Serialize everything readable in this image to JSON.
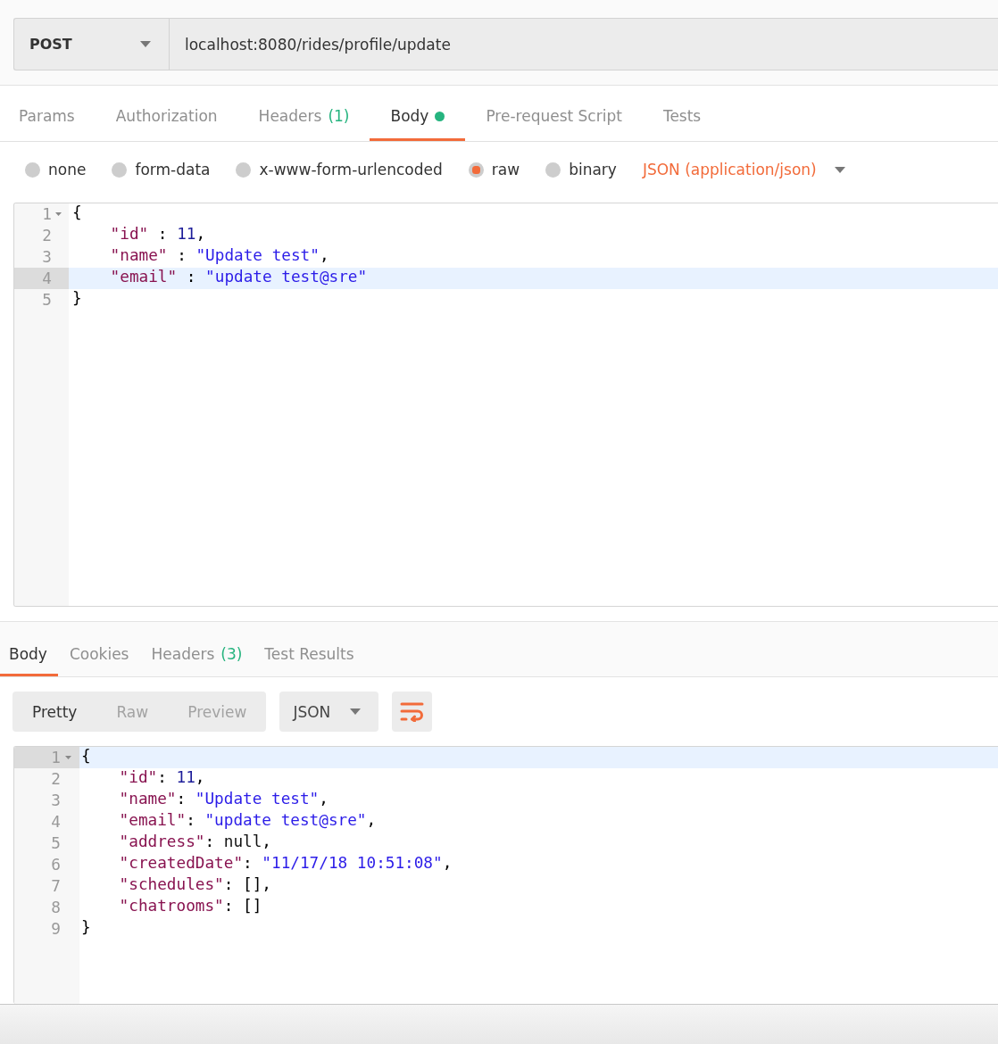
{
  "request": {
    "method": "POST",
    "url": "localhost:8080/rides/profile/update"
  },
  "request_tabs": [
    {
      "label": "Params",
      "selected": false,
      "indicator": false
    },
    {
      "label": "Authorization",
      "selected": false,
      "indicator": false
    },
    {
      "label": "Headers",
      "count": "(1)",
      "selected": false,
      "indicator": false
    },
    {
      "label": "Body",
      "selected": true,
      "indicator": true
    },
    {
      "label": "Pre-request Script",
      "selected": false,
      "indicator": false
    },
    {
      "label": "Tests",
      "selected": false,
      "indicator": false
    }
  ],
  "body_types": [
    {
      "label": "none",
      "selected": false
    },
    {
      "label": "form-data",
      "selected": false
    },
    {
      "label": "x-www-form-urlencoded",
      "selected": false
    },
    {
      "label": "raw",
      "selected": true
    },
    {
      "label": "binary",
      "selected": false
    }
  ],
  "content_type": {
    "label": "JSON (application/json)"
  },
  "request_body": {
    "lines": [
      {
        "number": "1",
        "foldable": true,
        "active": false,
        "tokens": [
          {
            "kind": "punct",
            "text": "{"
          }
        ],
        "children": [
          {
            "number": "2",
            "foldable": false,
            "active": false,
            "tokens": [
              {
                "kind": "key",
                "text": "\"id\""
              },
              {
                "kind": "punct",
                "text": " : "
              },
              {
                "kind": "number",
                "text": "11"
              },
              {
                "kind": "punct",
                "text": ","
              }
            ]
          },
          {
            "number": "3",
            "foldable": false,
            "active": false,
            "tokens": [
              {
                "kind": "key",
                "text": "\"name\""
              },
              {
                "kind": "punct",
                "text": " : "
              },
              {
                "kind": "string",
                "text": "\"Update test\""
              },
              {
                "kind": "punct",
                "text": ","
              }
            ]
          },
          {
            "number": "4",
            "foldable": false,
            "active": true,
            "tokens": [
              {
                "kind": "key",
                "text": "\"email\""
              },
              {
                "kind": "punct",
                "text": " : "
              },
              {
                "kind": "string",
                "text": "\"update test@sre\""
              }
            ]
          }
        ]
      },
      {
        "number": "5",
        "foldable": false,
        "active": false,
        "tokens": [
          {
            "kind": "punct",
            "text": "}"
          }
        ]
      }
    ]
  },
  "response_tabs": [
    {
      "label": "Body",
      "selected": true
    },
    {
      "label": "Cookies",
      "selected": false
    },
    {
      "label": "Headers",
      "count": "(3)",
      "selected": false
    },
    {
      "label": "Test Results",
      "selected": false
    }
  ],
  "view_modes": [
    {
      "label": "Pretty",
      "selected": true
    },
    {
      "label": "Raw",
      "selected": false
    },
    {
      "label": "Preview",
      "selected": false
    }
  ],
  "format": {
    "label": "JSON"
  },
  "wrap_lines": {
    "on": true
  },
  "response_body": {
    "lines": [
      {
        "number": "1",
        "foldable": true,
        "active": true,
        "tokens": [
          {
            "kind": "punct",
            "text": "{"
          }
        ],
        "children": [
          {
            "number": "2",
            "foldable": false,
            "active": false,
            "tokens": [
              {
                "kind": "key",
                "text": "\"id\""
              },
              {
                "kind": "punct",
                "text": ": "
              },
              {
                "kind": "number",
                "text": "11"
              },
              {
                "kind": "punct",
                "text": ","
              }
            ]
          },
          {
            "number": "3",
            "foldable": false,
            "active": false,
            "tokens": [
              {
                "kind": "key",
                "text": "\"name\""
              },
              {
                "kind": "punct",
                "text": ": "
              },
              {
                "kind": "string",
                "text": "\"Update test\""
              },
              {
                "kind": "punct",
                "text": ","
              }
            ]
          },
          {
            "number": "4",
            "foldable": false,
            "active": false,
            "tokens": [
              {
                "kind": "key",
                "text": "\"email\""
              },
              {
                "kind": "punct",
                "text": ": "
              },
              {
                "kind": "string",
                "text": "\"update test@sre\""
              },
              {
                "kind": "punct",
                "text": ","
              }
            ]
          },
          {
            "number": "5",
            "foldable": false,
            "active": false,
            "tokens": [
              {
                "kind": "key",
                "text": "\"address\""
              },
              {
                "kind": "punct",
                "text": ": "
              },
              {
                "kind": "null",
                "text": "null"
              },
              {
                "kind": "punct",
                "text": ","
              }
            ]
          },
          {
            "number": "6",
            "foldable": false,
            "active": false,
            "tokens": [
              {
                "kind": "key",
                "text": "\"createdDate\""
              },
              {
                "kind": "punct",
                "text": ": "
              },
              {
                "kind": "string",
                "text": "\"11/17/18 10:51:08\""
              },
              {
                "kind": "punct",
                "text": ","
              }
            ]
          },
          {
            "number": "7",
            "foldable": false,
            "active": false,
            "tokens": [
              {
                "kind": "key",
                "text": "\"schedules\""
              },
              {
                "kind": "punct",
                "text": ": "
              },
              {
                "kind": "punct",
                "text": "[]"
              },
              {
                "kind": "punct",
                "text": ","
              }
            ]
          },
          {
            "number": "8",
            "foldable": false,
            "active": false,
            "tokens": [
              {
                "kind": "key",
                "text": "\"chatrooms\""
              },
              {
                "kind": "punct",
                "text": ": "
              },
              {
                "kind": "punct",
                "text": "[]"
              }
            ]
          }
        ]
      },
      {
        "number": "9",
        "foldable": false,
        "active": false,
        "tokens": [
          {
            "kind": "punct",
            "text": "}"
          }
        ]
      }
    ]
  }
}
